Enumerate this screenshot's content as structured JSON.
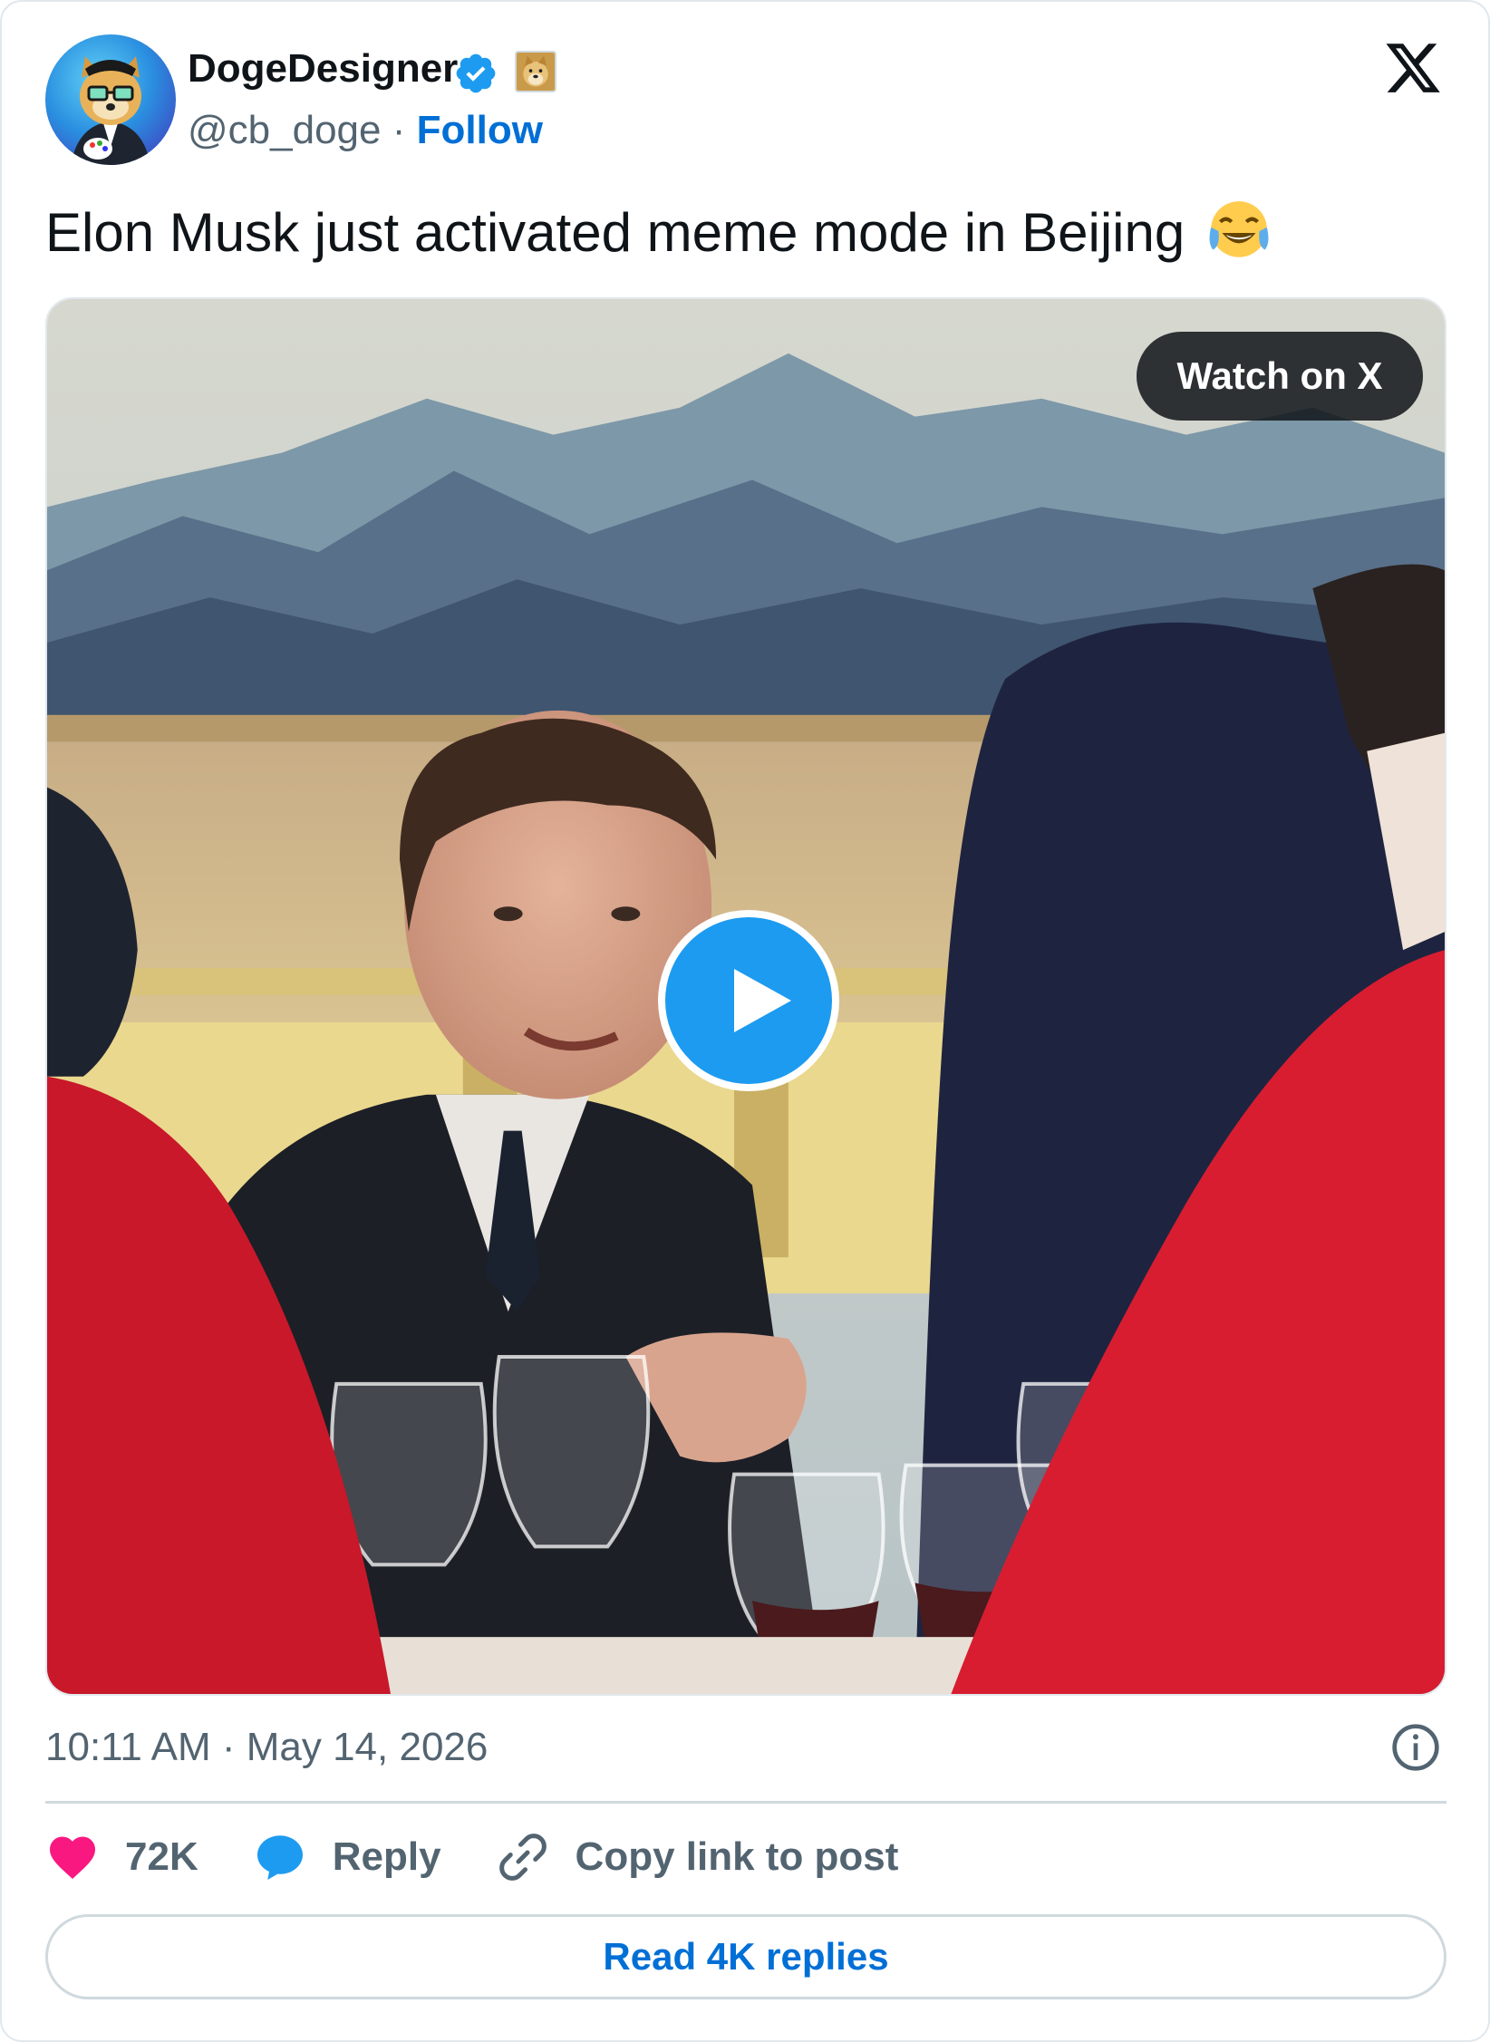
{
  "author": {
    "display_name": "DogeDesigner",
    "handle": "@cb_doge",
    "separator": " · ",
    "follow_label": "Follow"
  },
  "tweet": {
    "text": "Elon Musk just activated meme mode in Beijing",
    "emoji": "face-with-tears-of-joy"
  },
  "media": {
    "watch_label": "Watch on X"
  },
  "meta": {
    "timestamp": "10:11 AM · May 14, 2026"
  },
  "actions": {
    "likes": "72K",
    "reply_label": "Reply",
    "copy_label": "Copy link to post"
  },
  "read_replies_label": "Read 4K replies",
  "colors": {
    "link": "#006fd6",
    "verified": "#1d9bf0",
    "like": "#f91880",
    "muted": "#536471"
  }
}
